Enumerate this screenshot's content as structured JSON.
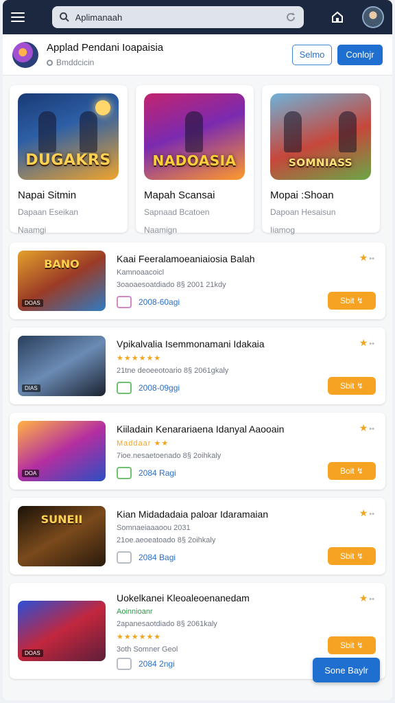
{
  "header": {
    "search_text": "Aplimanaah"
  },
  "profile": {
    "title": "Applad Pendani Ioapaisia",
    "subtitle": "Bmddcicin",
    "outline_button": "Selmo",
    "solid_button": "Conlojr"
  },
  "featured": [
    {
      "art_title": "DUGAKRS",
      "title": "Napai Sitmin",
      "subtitle": "Dapaan Eseikan",
      "meta": "Naamgi"
    },
    {
      "art_title": "NADOASIA",
      "title": "Mapah Scansai",
      "subtitle": "Sapnaad Bcatoen",
      "meta": "Naamign"
    },
    {
      "art_title": "SOMNIASS",
      "title": "Mopai :Shoan",
      "subtitle": "Dapoan Hesaisun",
      "meta": "Iiamog"
    }
  ],
  "list": [
    {
      "title": "Kaai Feeralamoeaniaiosia Balah",
      "line1": "Kamnoaacoicl",
      "line2": "3oaoaesoatdiado 8§ 2001 21kdy",
      "size": "2008-60agi",
      "art_title": "BANO",
      "label": "DOAS",
      "button": "Sbit"
    },
    {
      "title": "Vpikalvalia Isemmonamani Idakaia",
      "line1": "★★★★★★",
      "line2": "21tne deoeeotoario 8§ 2061gkaly",
      "size": "2008-09ggi",
      "art_title": "",
      "label": "DIAS",
      "button": "Sbit"
    },
    {
      "title": "Kiiladain Kenarariaena Idanyal Aaooain",
      "line1": "Maddaar ★★",
      "line2": "7ioe.nesaetoenado 8§ 2oihkaly",
      "size": "2084 Ragi",
      "art_title": "",
      "label": "DOA",
      "button": "Boit"
    },
    {
      "title": "Kian Midadadaia paloar Idaramaian",
      "line1": "Somnaeiaaaoou 2031",
      "line2": "21oe.aeoeatoado 8§ 2oihkaly",
      "size": "2084 Bagi",
      "art_title": "SUNEII",
      "label": "",
      "button": "Sbit"
    },
    {
      "title": "Uokelkanei Kleoaleoenanedam",
      "line1": "Aoinnioanr",
      "line2": "2apanesaotdiado 8§ 2061kaly",
      "line3": "★★★★★★",
      "line4": "3oth Somner Geol",
      "size": "2084 2ngi",
      "art_title": "",
      "label": "DOAS",
      "button": "Sbit"
    }
  ],
  "fab_label": "Sone Baylr",
  "colors": {
    "topbar": "#1c2740",
    "accent_blue": "#1f6fd1",
    "accent_orange": "#f6a323",
    "star": "#f2a41d"
  }
}
